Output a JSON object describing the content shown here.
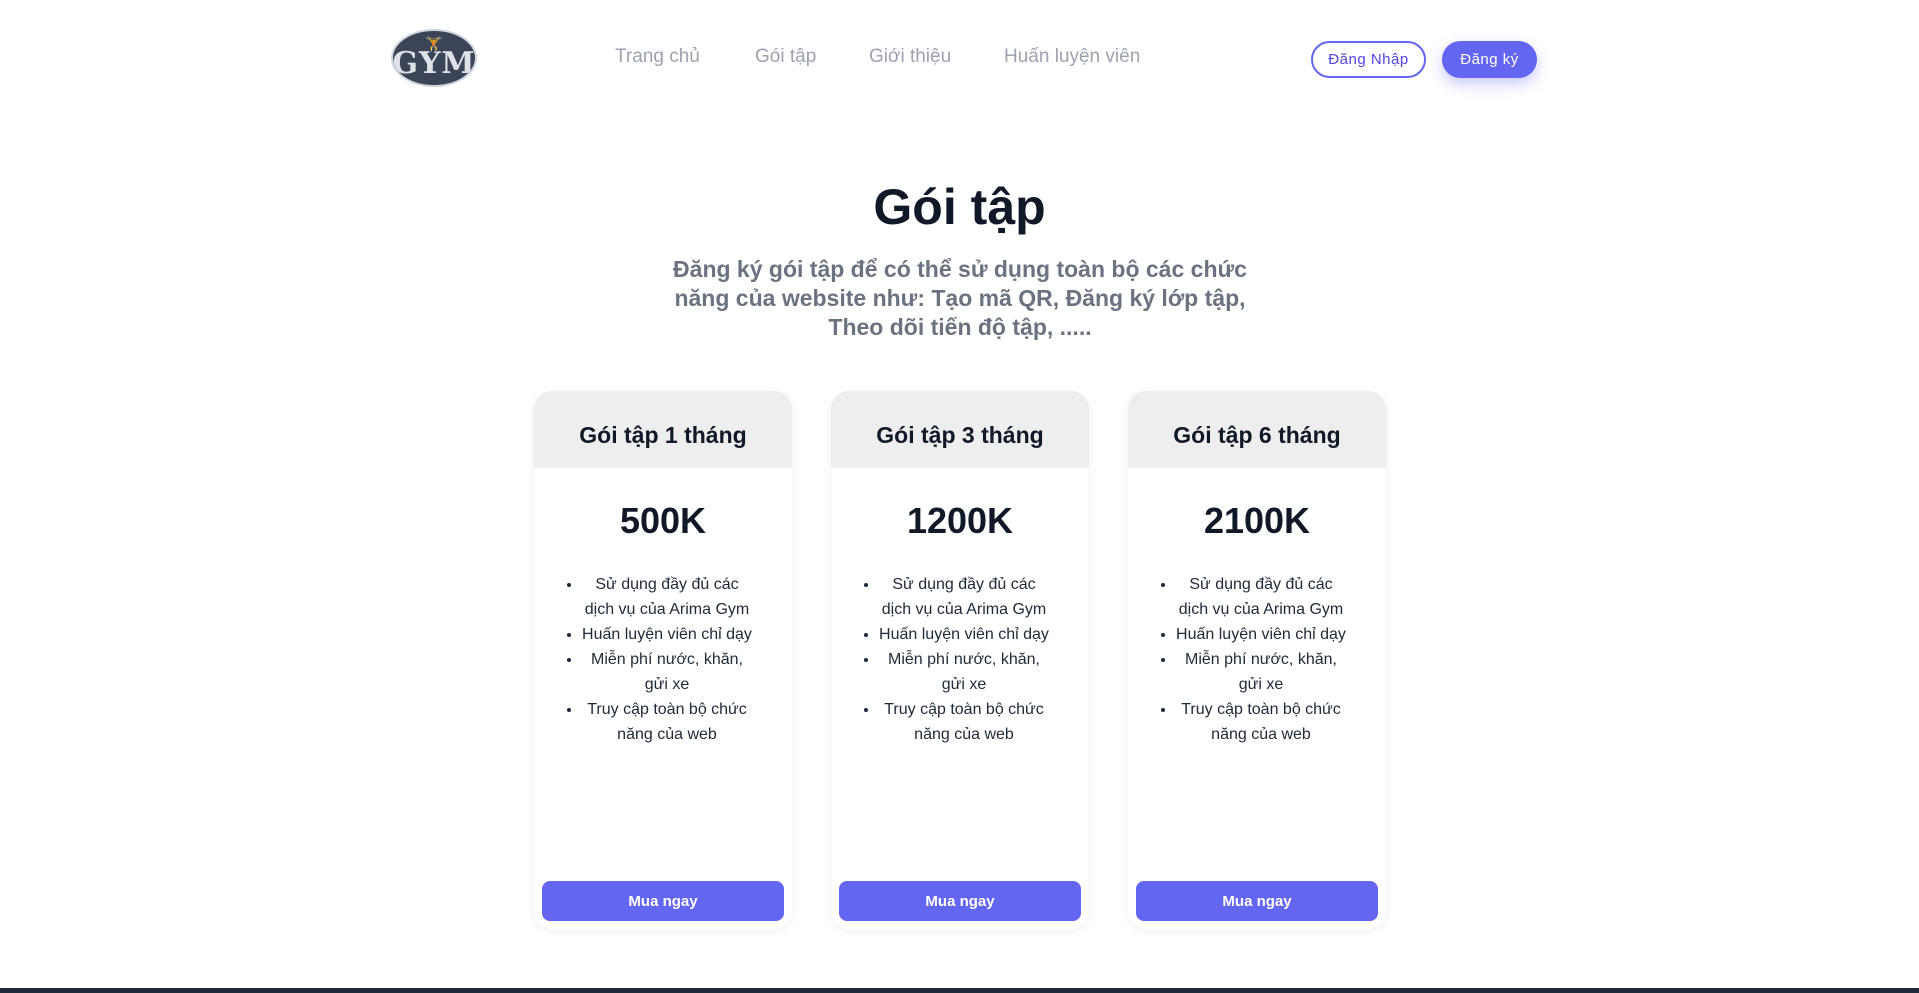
{
  "header": {
    "logo": {
      "text": "GYM",
      "figure": "🏋",
      "icon": "gym-logo-icon"
    },
    "nav": [
      {
        "label": "Trang chủ"
      },
      {
        "label": "Gói tập"
      },
      {
        "label": "Giới thiệu"
      },
      {
        "label": "Huấn luyện viên"
      }
    ],
    "login_label": "Đăng Nhập",
    "register_label": "Đăng ký"
  },
  "hero": {
    "title": "Gói tập",
    "subtitle": "Đăng ký gói tập để có thể sử dụng toàn bộ các chức năng của website như: Tạo mã QR, Đăng ký lớp tập, Theo dõi tiến độ tập, ....."
  },
  "plans": [
    {
      "name": "Gói tập 1 tháng",
      "price": "500K",
      "features": [
        "Sử dụng đầy đủ các dịch vụ của Arima Gym",
        "Huấn luyện viên chỉ dạy",
        "Miễn phí nước, khăn, gửi xe",
        "Truy cập toàn bộ chức năng của web"
      ],
      "button_label": "Mua ngay"
    },
    {
      "name": "Gói tập 3 tháng",
      "price": "1200K",
      "features": [
        "Sử dụng đầy đủ các dịch vụ của Arima Gym",
        "Huấn luyện viên chỉ dạy",
        "Miễn phí nước, khăn, gửi xe",
        "Truy cập toàn bộ chức năng của web"
      ],
      "button_label": "Mua ngay"
    },
    {
      "name": "Gói tập 6 tháng",
      "price": "2100K",
      "features": [
        "Sử dụng đầy đủ các dịch vụ của Arima Gym",
        "Huấn luyện viên chỉ dạy",
        "Miễn phí nước, khăn, gửi xe",
        "Truy cập toàn bộ chức năng của web"
      ],
      "button_label": "Mua ngay"
    }
  ],
  "colors": {
    "accent": "#6366f1",
    "nav_text": "#9ca3af",
    "subtitle_text": "#6b7280",
    "card_header_bg": "#eeeeee"
  }
}
